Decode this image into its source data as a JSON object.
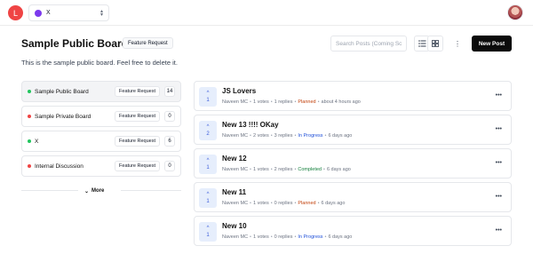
{
  "topbar": {
    "org_initial": "L",
    "project_name": "X",
    "project_color": "#7c3aed",
    "org_color": "#ef4444"
  },
  "board": {
    "title": "Sample Public Board",
    "badge": "Feature Request",
    "description": "This is the sample public board. Feel free to delete it.",
    "search_placeholder": "Search Posts (Coming Soon)",
    "new_post_label": "New Post"
  },
  "boards": [
    {
      "name": "Sample Public Board",
      "tag": "Feature Request",
      "count": "14",
      "dot": "#22c55e",
      "active": true
    },
    {
      "name": "Sample Private Board",
      "tag": "Feature Request",
      "count": "0",
      "dot": "#ef4444",
      "active": false
    },
    {
      "name": "X",
      "tag": "Feature Request",
      "count": "6",
      "dot": "#22c55e",
      "active": false
    },
    {
      "name": "Internal Discussion",
      "tag": "Feature Request",
      "count": "0",
      "dot": "#ef4444",
      "active": false
    }
  ],
  "more_label": "More",
  "posts": [
    {
      "title": "JS Lovers",
      "votes": "1",
      "author": "Naveen MC",
      "votes_text": "1 votes",
      "replies": "1 replies",
      "status": "Planned",
      "status_color": "#c2410c",
      "time": "about 4 hours ago"
    },
    {
      "title": "New 13 !!!! OKay",
      "votes": "2",
      "author": "Naveen MC",
      "votes_text": "2 votes",
      "replies": "3 replies",
      "status": "In Progress",
      "status_color": "#1d4ed8",
      "time": "6 days ago"
    },
    {
      "title": "New 12",
      "votes": "1",
      "author": "Naveen MC",
      "votes_text": "1 votes",
      "replies": "2 replies",
      "status": "Completed",
      "status_color": "#15803d",
      "time": "6 days ago"
    },
    {
      "title": "New 11",
      "votes": "1",
      "author": "Naveen MC",
      "votes_text": "1 votes",
      "replies": "0 replies",
      "status": "Planned",
      "status_color": "#c2410c",
      "time": "6 days ago"
    },
    {
      "title": "New 10",
      "votes": "1",
      "author": "Naveen MC",
      "votes_text": "1 votes",
      "replies": "0 replies",
      "status": "In Progress",
      "status_color": "#1d4ed8",
      "time": "6 days ago"
    }
  ]
}
